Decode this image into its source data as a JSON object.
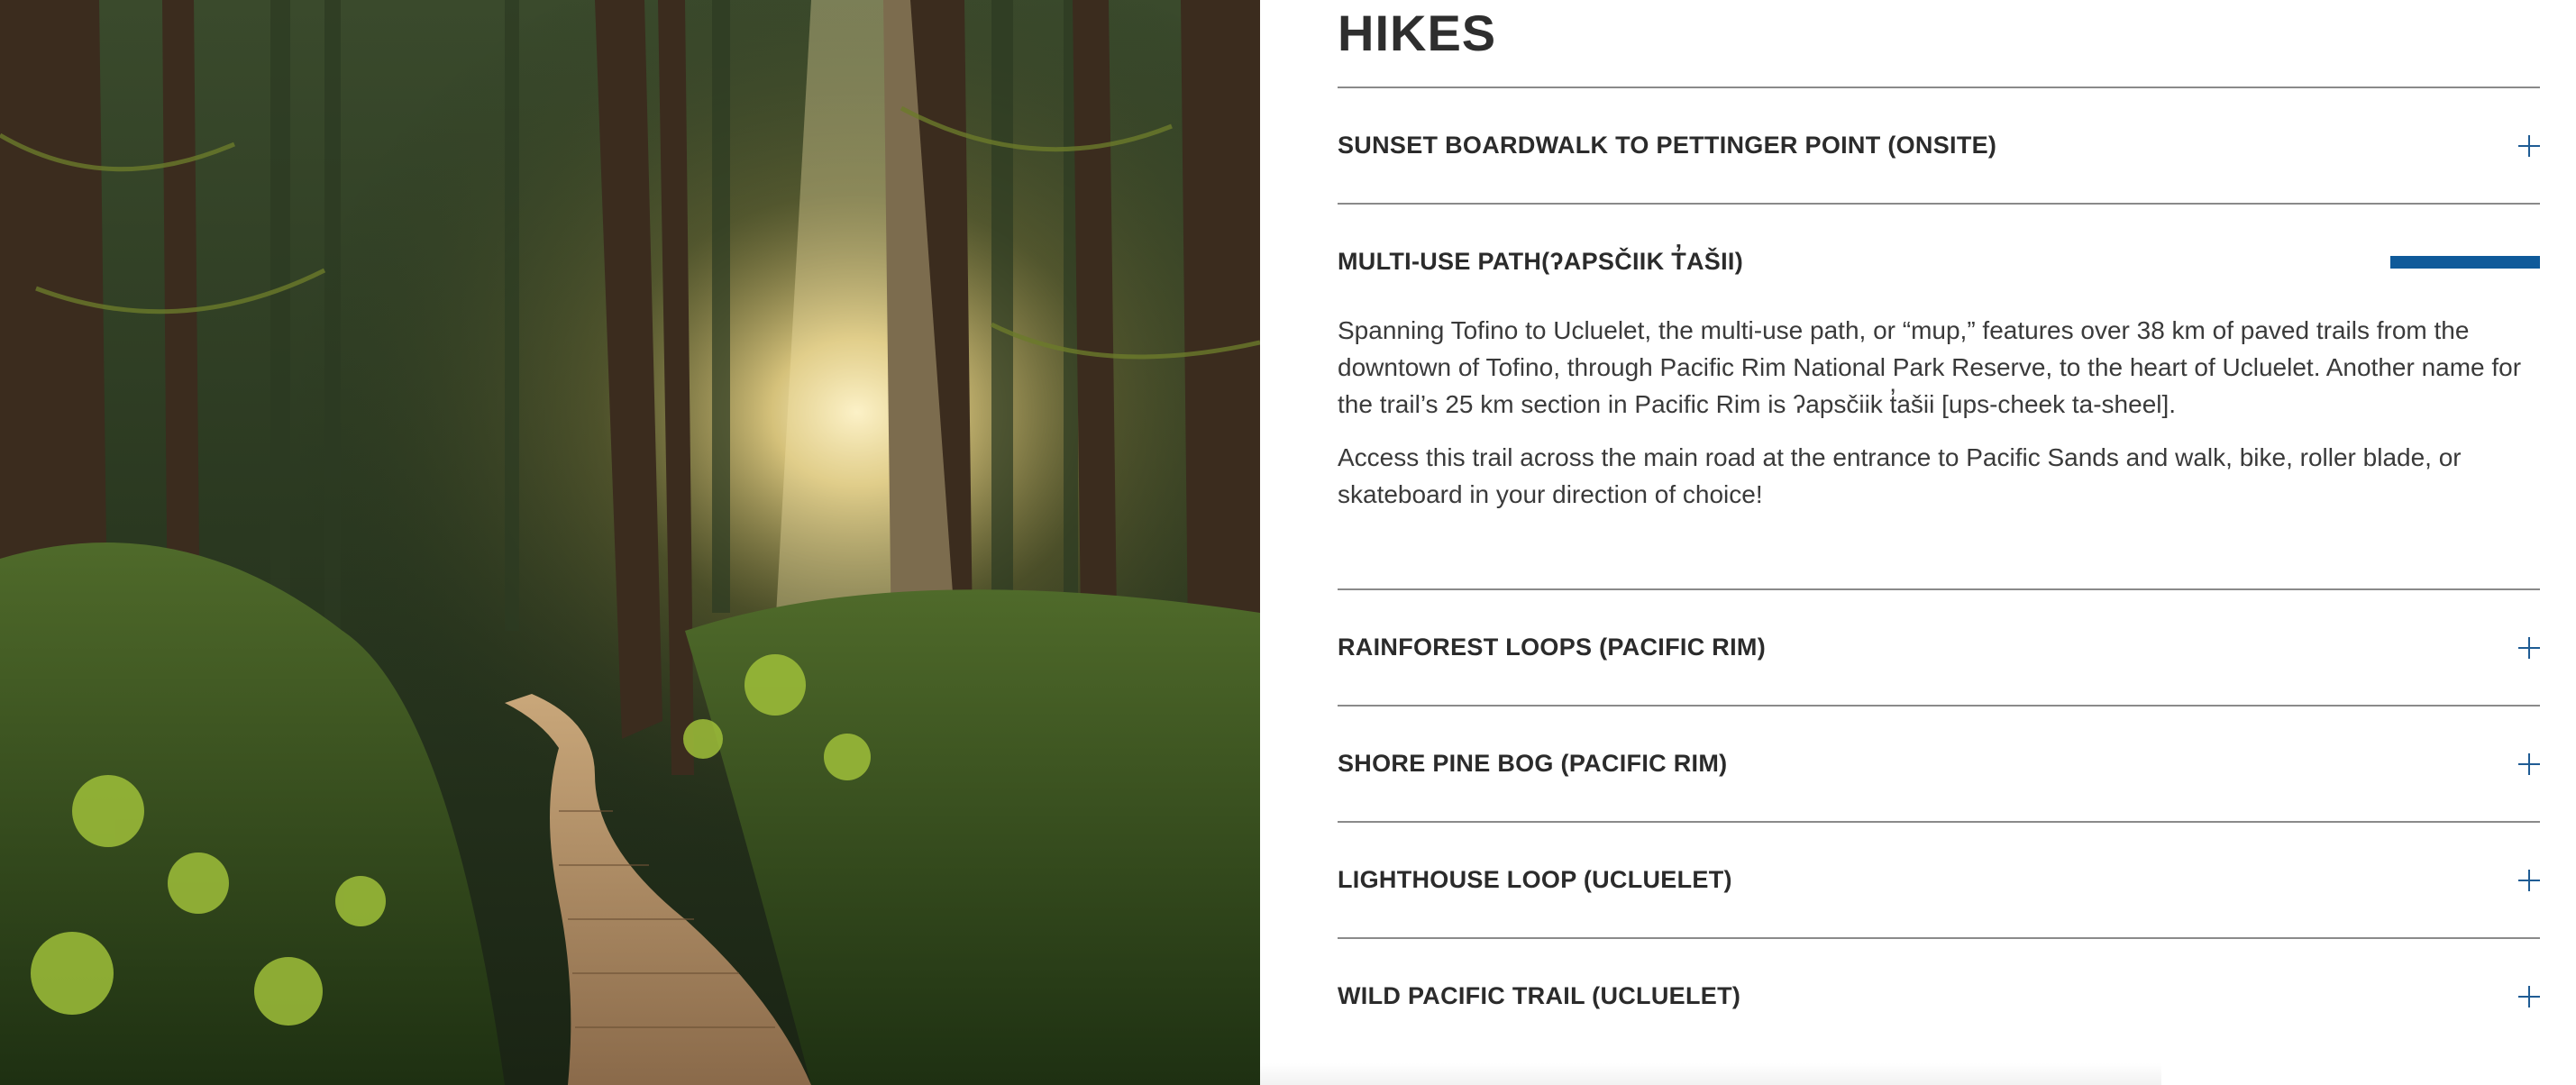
{
  "section_title": "HIKES",
  "accordion": {
    "items": [
      {
        "title": "SUNSET BOARDWALK TO PETTINGER POINT (ONSITE)",
        "expanded": false
      },
      {
        "title": "MULTI-USE PATH(ʔAPSČIIK T̓AŠII)",
        "expanded": true,
        "paragraphs": [
          "Spanning Tofino to Ucluelet, the multi-use path, or “mup,” features over 38 km of paved trails from the downtown of Tofino, through Pacific Rim National Park Reserve, to the heart of Ucluelet. Another name for the trail’s 25 km section in Pacific Rim is ʔapsčiik t̓ašii [ups-cheek ta-sheel].",
          "Access this trail across the main road at the entrance to Pacific Sands and walk, bike, roller blade, or skateboard in your direction of choice!"
        ]
      },
      {
        "title": "RAINFOREST LOOPS (PACIFIC RIM)",
        "expanded": false
      },
      {
        "title": "SHORE PINE BOG (PACIFIC RIM)",
        "expanded": false
      },
      {
        "title": "LIGHTHOUSE LOOP (UCLUELET)",
        "expanded": false
      },
      {
        "title": "WILD PACIFIC TRAIL (UCLUELET)",
        "expanded": false
      }
    ]
  },
  "icons": {
    "expand": "plus-icon",
    "collapse": "minus-icon"
  },
  "colors": {
    "accent": "#0f5a9a",
    "divider": "#8a8a8a",
    "text": "#2b2b2b"
  }
}
